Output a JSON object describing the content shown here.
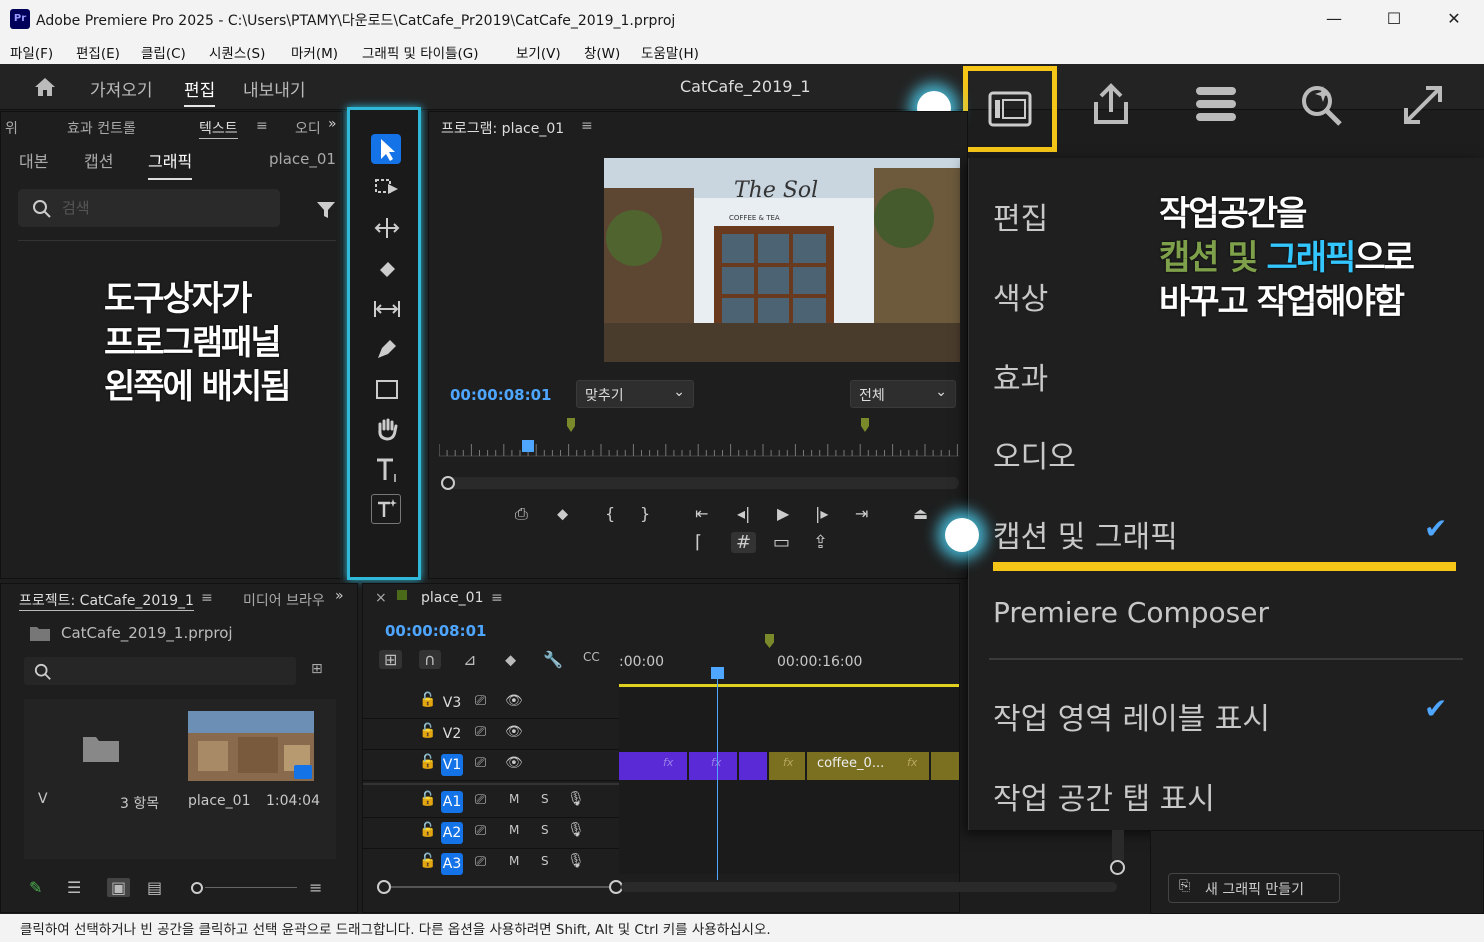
{
  "window": {
    "app_title": "Adobe Premiere Pro 2025 - C:\\Users\\PTAMY\\다운로드\\CatCafe_Pr2019\\CatCafe_2019_1.prproj",
    "minimize": "—",
    "maximize": "☐",
    "close": "✕",
    "app_icon": "Pr"
  },
  "menu": [
    "파일(F)",
    "편집(E)",
    "클립(C)",
    "시퀀스(S)",
    "마커(M)",
    "그래픽 및 타이틀(G)",
    "보기(V)",
    "창(W)",
    "도움말(H)"
  ],
  "header": {
    "tabs": [
      "가져오기",
      "편집",
      "내보내기"
    ],
    "active_tab": "편집",
    "project_name": "CatCafe_2019_1"
  },
  "left_panel": {
    "tabs": [
      "위",
      "효과 컨트롤",
      "텍스트",
      "오디"
    ],
    "subtabs": [
      "대본",
      "캡션",
      "그래픽"
    ],
    "active_subtab": "그래픽",
    "clip": "place_01",
    "search_placeholder": "검색"
  },
  "annotation_left": [
    "도구상자가",
    "프로그램패널",
    "왼쪽에 배치됨"
  ],
  "program": {
    "title": "프로그램: place_01",
    "timecode": "00:00:08:01",
    "fit": "맞추기",
    "quality": "전체",
    "sign_text": "The Sol",
    "sign_sub": "COFFEE & TEA"
  },
  "project": {
    "title": "프로젝트: CatCafe_2019_1",
    "tab2": "미디어 브라우",
    "file": "CatCafe_2019_1.prproj",
    "col_v": "V",
    "items_count": "3 항목",
    "clip_name": "place_01",
    "clip_duration": "1:04:04"
  },
  "timeline": {
    "title": "place_01",
    "timecode": "00:00:08:01",
    "ruler": [
      ":00:00",
      "00:00:16:00"
    ],
    "video_tracks": [
      "V3",
      "V2",
      "V1"
    ],
    "audio_tracks": [
      "A1",
      "A2",
      "A3"
    ],
    "mute": "M",
    "solo": "S",
    "clip_label": "coffee_0...",
    "fx": "fx"
  },
  "workspace_menu": {
    "items": [
      "편집",
      "색상",
      "효과",
      "오디오",
      "캡션 및 그래픽",
      "Premiere Composer"
    ],
    "selected": "캡션 및 그래픽",
    "options": [
      "작업 영역 레이블 표시",
      "작업 공간 탭 표시"
    ],
    "check": "✔"
  },
  "annotation_right": {
    "line1": "작업공간을",
    "line2_a": "캡션 및",
    "line2_b": "그래픽",
    "line2_c": "으로",
    "line3": "바꾸고 작업해야함"
  },
  "new_graphic": "새 그래픽 만들기",
  "status": "클릭하여 선택하거나 빈 공간을 클릭하고 선택 윤곽으로 드래그합니다. 다른 옵션을 사용하려면 Shift, Alt 및 Ctrl 키를 사용하십시오.",
  "colors": {
    "accent": "#1473e6",
    "highlight": "#f5c518",
    "cyan": "#33c6ff",
    "timecode": "#4ea6ff",
    "v1clip": "#5a2ad6",
    "v1clip2": "#7a7020"
  }
}
